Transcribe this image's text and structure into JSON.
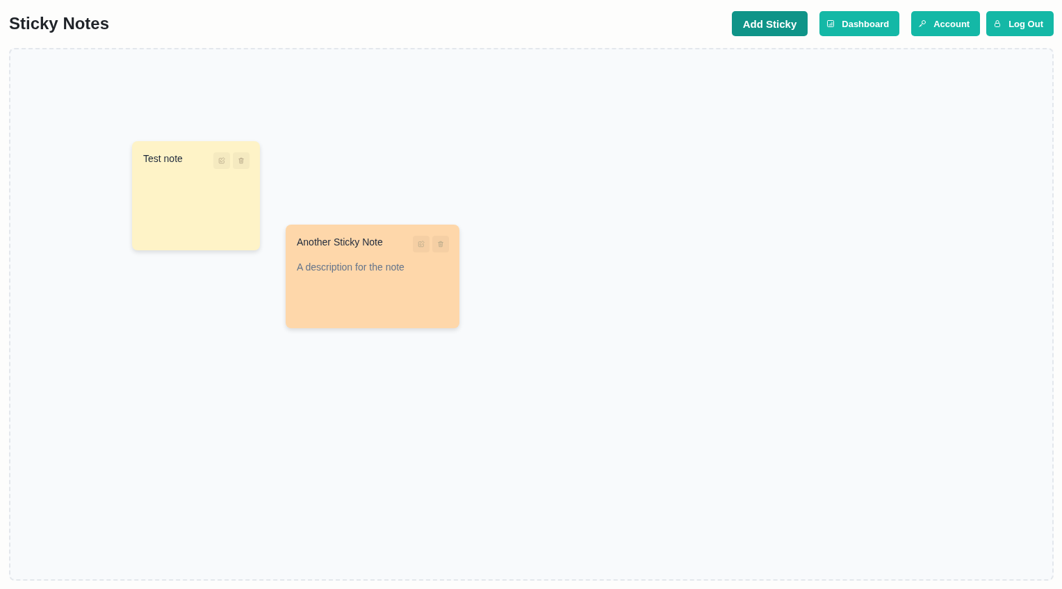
{
  "header": {
    "title": "Sticky Notes",
    "buttons": [
      {
        "label": "Add Sticky",
        "kind": "primary"
      },
      {
        "label": "Dashboard",
        "kind": "secondary"
      },
      {
        "label": "Account",
        "kind": "secondary"
      },
      {
        "label": "Log Out",
        "kind": "secondary"
      }
    ]
  },
  "board": {
    "notes": [
      {
        "title": "Test note",
        "color": "#fef3c7"
      },
      {
        "title": "Another Sticky Note",
        "description": "A description for the note",
        "color": "#fed7aa"
      }
    ]
  }
}
